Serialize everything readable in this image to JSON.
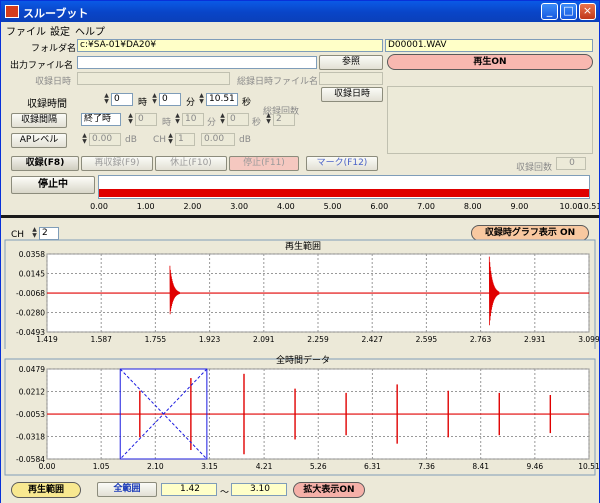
{
  "window": {
    "title": "スルーブット"
  },
  "menu": [
    "ファイル",
    "設定",
    "ヘルプ"
  ],
  "form": {
    "folder_label": "フォルダ名",
    "folder_value": "c:¥SA-01¥DA20¥",
    "file_value": "D00001.WAV",
    "output_label": "出力ファイル名",
    "browse_label": "参照",
    "play_status": "再生ON",
    "recorded_datetime_label": "収録日時",
    "total_file_label": "総録日時ファイル名",
    "rec_datetime_button": "収録日時",
    "rec_time_label": "収録時間",
    "rec_hours": "0",
    "hours_unit": "時",
    "rec_minutes": "0",
    "minutes_unit": "分",
    "rec_seconds": "10.51",
    "seconds_unit": "秒",
    "total_count_label": "総録回数",
    "interval_button": "収録間隔",
    "interval_mode": "終了時",
    "interval_h": "0",
    "interval_m": "10",
    "interval_s": "0",
    "interval_h_unit": "時",
    "interval_m_unit": "分",
    "interval_s_unit": "秒",
    "interval_count": "2",
    "ap_button": "APレベル",
    "ap_value": "0.00",
    "ap_unit": "dB",
    "ch_label": "CH",
    "ch_value": "1",
    "db_value": "0.00",
    "db_unit": "dB"
  },
  "controls": {
    "record": "収録(F8)",
    "rerecord": "再収録(F9)",
    "pause": "休止(F10)",
    "stop": "停止(F11)",
    "mark": "マーク(F12)",
    "rec_count_label": "収録回数",
    "rec_count_value": "0",
    "status": "停止中"
  },
  "timeline": {
    "ticks": [
      "0.00",
      "1.00",
      "2.00",
      "3.00",
      "4.00",
      "5.00",
      "6.00",
      "7.00",
      "8.00",
      "9.00",
      "10.00",
      "10.51"
    ]
  },
  "playback": {
    "ch_label": "CH",
    "ch_value": "2",
    "title": "再生範囲",
    "graph_toggle": "収録時グラフ表示 ON",
    "y_ticks": [
      "0.0358",
      "0.0145",
      "-0.0068",
      "-0.0280",
      "-0.0493"
    ],
    "x_ticks": [
      "1.419",
      "1.587",
      "1.755",
      "1.923",
      "2.091",
      "2.259",
      "2.427",
      "2.595",
      "2.763",
      "2.931",
      "3.099"
    ]
  },
  "overview": {
    "title": "全時間データ",
    "y_ticks": [
      "0.0479",
      "0.0212",
      "-0.0053",
      "-0.0318",
      "-0.0584"
    ],
    "x_ticks": [
      "0.00",
      "1.05",
      "2.10",
      "3.15",
      "4.21",
      "5.26",
      "6.31",
      "7.36",
      "8.41",
      "9.46",
      "10.51"
    ]
  },
  "footer": {
    "play_range": "再生範囲",
    "full_range": "全範囲",
    "range_start": "1.42",
    "range_sep": "～",
    "range_end": "3.10",
    "zoom": "拡大表示ON"
  },
  "colors": {
    "signal": "#e00000",
    "accent_pink": "#f5a8a0",
    "accent_orange": "#f8c8a0",
    "accent_yellow": "#f8e890",
    "selection": "#1a1ae0"
  },
  "chart_data": [
    {
      "type": "line",
      "title": "再生範囲",
      "xlim": [
        1.419,
        3.099
      ],
      "ylim": [
        -0.0493,
        0.0358
      ],
      "series": [
        {
          "x": [
            1.419,
            1.8,
            1.805,
            1.81,
            1.82,
            1.84,
            2.79,
            2.795,
            2.8,
            2.81,
            2.84,
            3.099
          ],
          "y": [
            -0.0068,
            -0.0068,
            0.023,
            -0.03,
            0.012,
            -0.0068,
            -0.0068,
            0.033,
            -0.042,
            0.015,
            -0.0068,
            -0.0068
          ]
        }
      ]
    },
    {
      "type": "line",
      "title": "全時間データ",
      "xlim": [
        0.0,
        10.51
      ],
      "ylim": [
        -0.0584,
        0.0479
      ],
      "spike_times": [
        1.8,
        2.79,
        3.82,
        4.81,
        5.8,
        6.79,
        7.78,
        8.77,
        9.76
      ],
      "selection": [
        1.42,
        3.1
      ]
    }
  ]
}
